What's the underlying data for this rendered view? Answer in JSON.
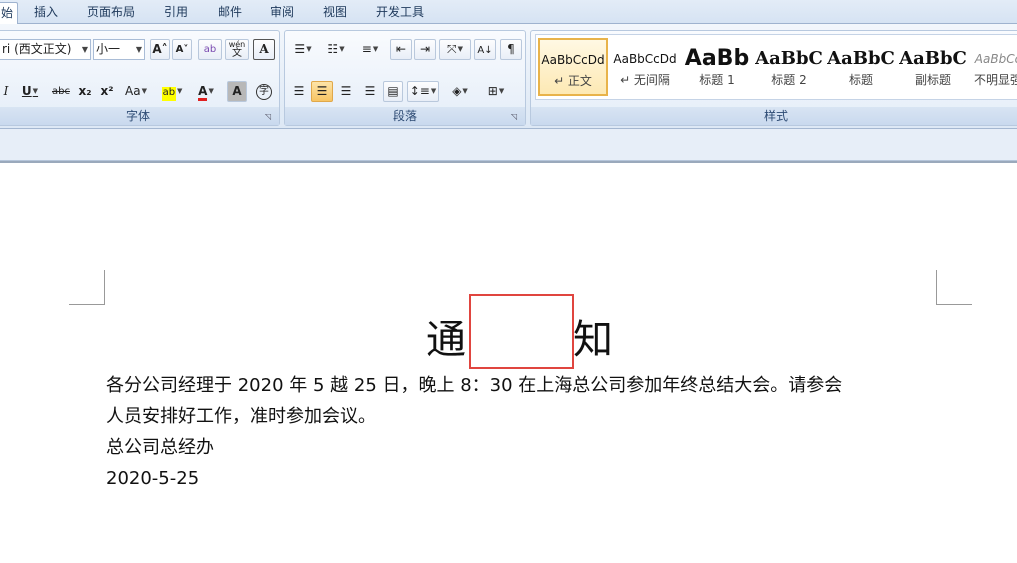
{
  "tabs": [
    {
      "label": "始"
    },
    {
      "label": "插入"
    },
    {
      "label": "页面布局"
    },
    {
      "label": "引用"
    },
    {
      "label": "邮件"
    },
    {
      "label": "审阅"
    },
    {
      "label": "视图"
    },
    {
      "label": "开发工具"
    }
  ],
  "font_group": {
    "label": "字体",
    "font_name": "ri (西文正文)",
    "font_size": "小一",
    "grow_font": "A˄",
    "shrink_font": "A˅",
    "clear_format": "ab",
    "phonetic_top": "wén",
    "phonetic_bottom": "文",
    "char_border": "A",
    "italic": "I",
    "underline": "U",
    "strikethrough": "abc",
    "subscript": "x₂",
    "superscript": "x²",
    "change_case": "Aa",
    "highlight": "ab",
    "font_color": "A",
    "char_shading": "A",
    "enclose_char": "字"
  },
  "paragraph_group": {
    "label": "段落"
  },
  "styles_group": {
    "label": "样式",
    "items": [
      {
        "sample": "AaBbCcDd",
        "name": "↵ 正文"
      },
      {
        "sample": "AaBbCcDd",
        "name": "↵ 无间隔"
      },
      {
        "sample": "AaBb",
        "name": "标题 1"
      },
      {
        "sample": "AaBbC",
        "name": "标题 2"
      },
      {
        "sample": "AaBbC",
        "name": "标题"
      },
      {
        "sample": "AaBbC",
        "name": "副标题"
      },
      {
        "sample": "AaBbCc",
        "name": "不明显强"
      }
    ]
  },
  "document": {
    "title_char_1": "通",
    "title_char_2": "知",
    "line_1": "各分公司经理于 2020 年 5 越 25 日，晚上 8：30 在上海总公司参加年终总结大会。请参会",
    "line_2": "人员安排好工作，准时参加会议。",
    "line_3": "总公司总经办",
    "line_4": "2020-5-25"
  },
  "colors": {
    "highlight_box": "#e0453f",
    "selected_style": "#e8b34a",
    "ribbon_text": "#1e395b"
  }
}
